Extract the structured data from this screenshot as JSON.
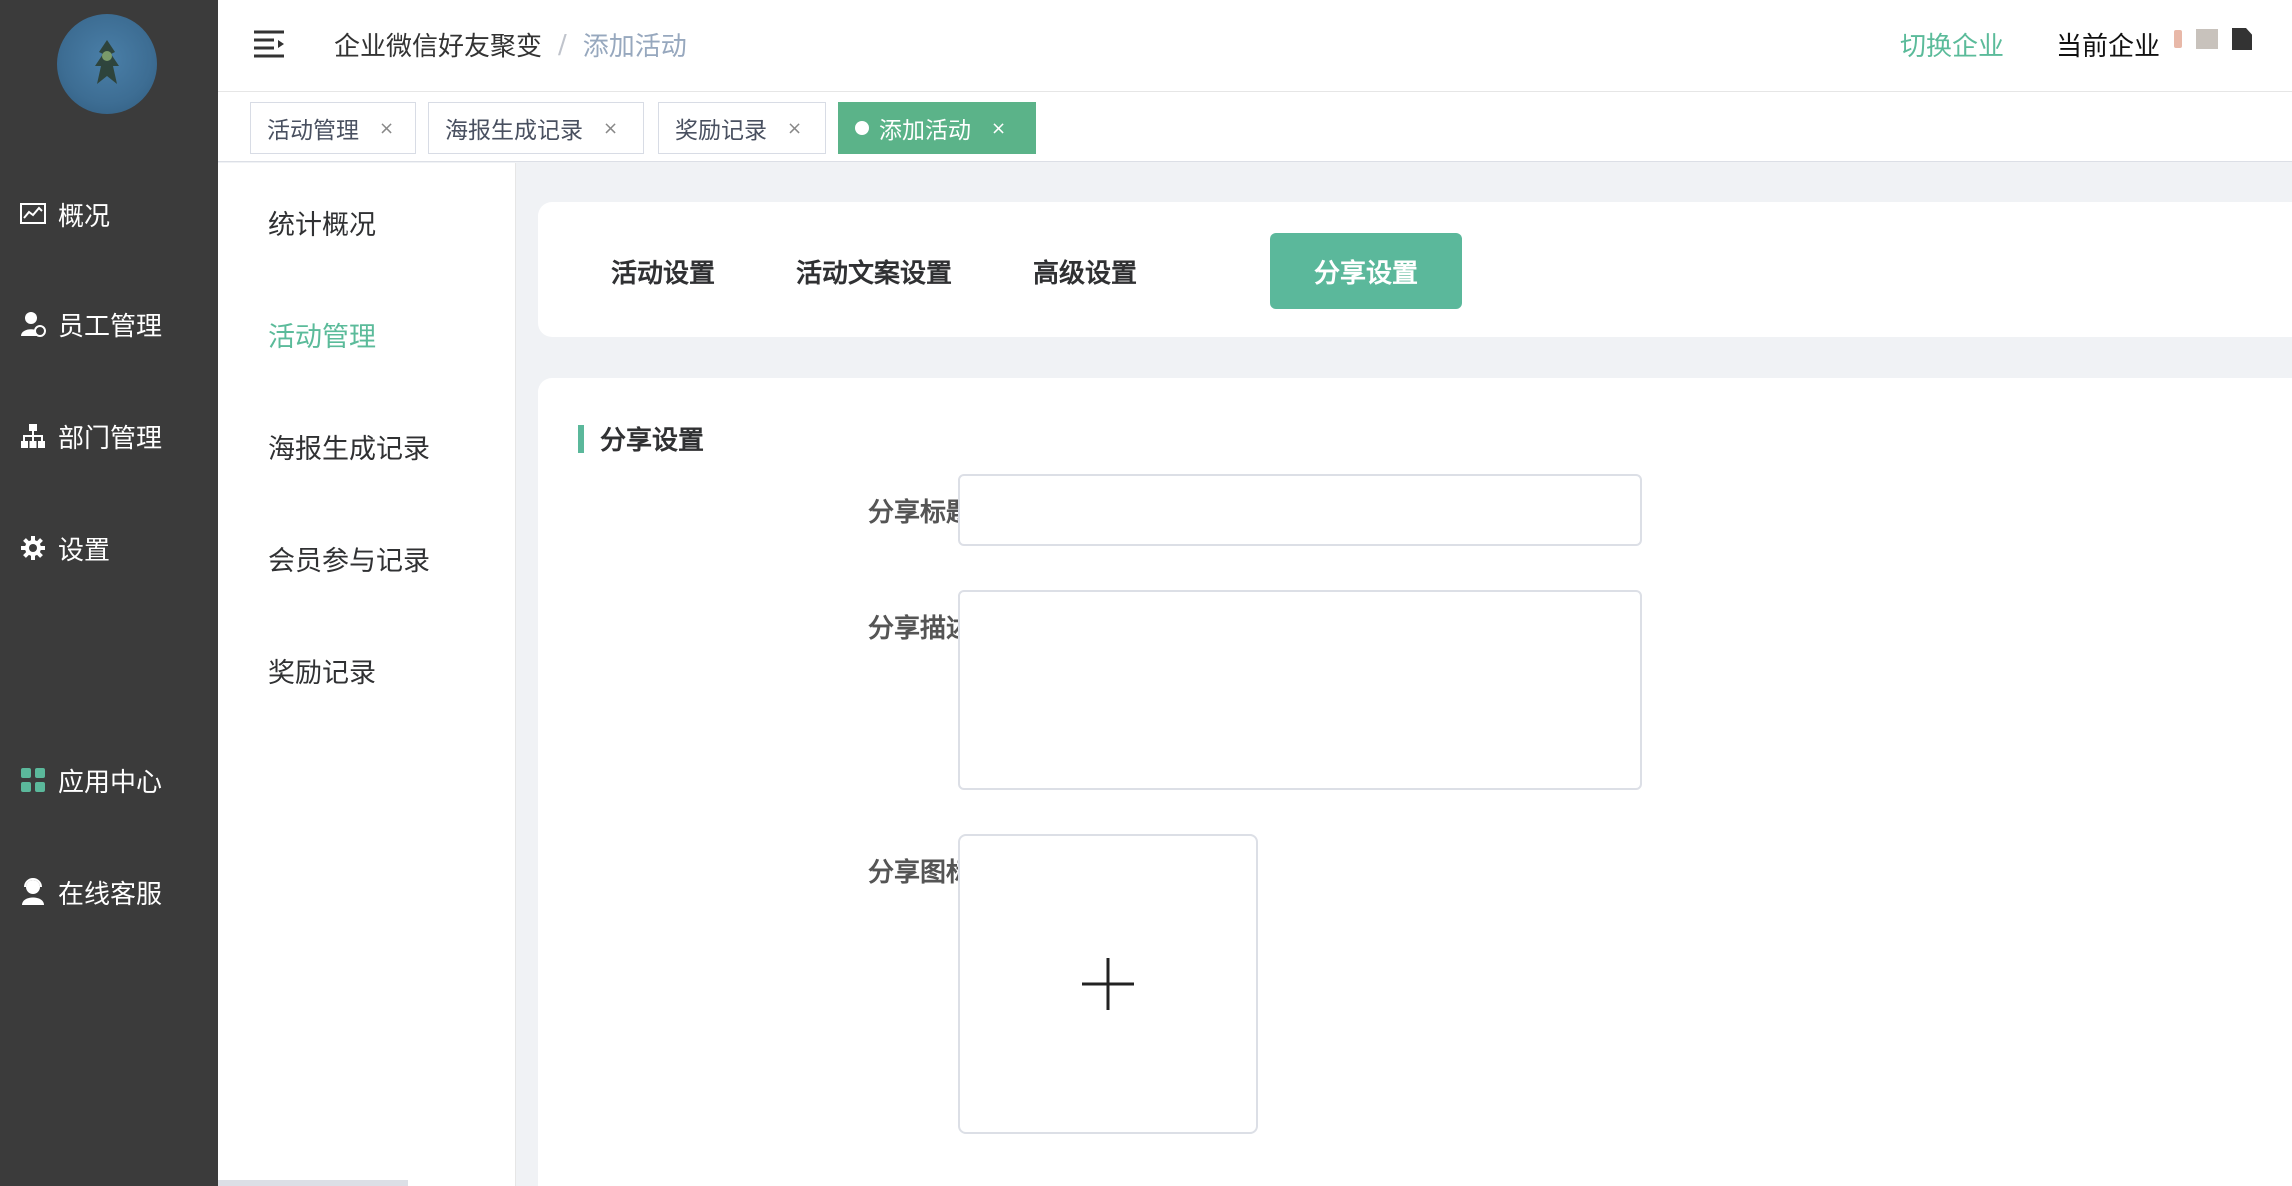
{
  "sidebar": {
    "items": [
      {
        "label": "概况",
        "icon": "chart-icon"
      },
      {
        "label": "员工管理",
        "icon": "user-gear-icon"
      },
      {
        "label": "部门管理",
        "icon": "org-tree-icon"
      },
      {
        "label": "设置",
        "icon": "gear-icon"
      },
      {
        "label": "应用中心",
        "icon": "apps-grid-icon"
      },
      {
        "label": "在线客服",
        "icon": "support-agent-icon"
      }
    ]
  },
  "header": {
    "breadcrumb_root": "企业微信好友聚变",
    "breadcrumb_sep": "/",
    "breadcrumb_current": "添加活动",
    "switch_label": "切换企业",
    "current_label": "当前企业"
  },
  "tags": [
    {
      "label": "活动管理",
      "close": "×"
    },
    {
      "label": "海报生成记录",
      "close": "×"
    },
    {
      "label": "奖励记录",
      "close": "×"
    },
    {
      "label": "添加活动",
      "close": "×",
      "active": true
    }
  ],
  "submenu": {
    "items": [
      "统计概况",
      "活动管理",
      "海报生成记录",
      "会员参与记录",
      "奖励记录"
    ],
    "active": "活动管理"
  },
  "tabs": [
    "活动设置",
    "活动文案设置",
    "高级设置",
    "分享设置"
  ],
  "active_tab": "分享设置",
  "form": {
    "section_title": "分享设置",
    "title_label": "分享标题",
    "title_value": "",
    "desc_label": "分享描述",
    "desc_value": "",
    "icon_label": "分享图标"
  },
  "colors": {
    "accent": "#5bb89b",
    "sidebar_bg": "#3b3b3b",
    "breadcrumb_current": "#97a8be"
  }
}
